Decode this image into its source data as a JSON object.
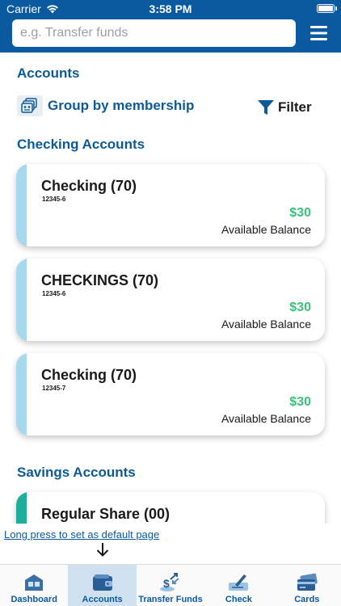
{
  "status_bar": {
    "carrier": "Carrier",
    "time": "3:58 PM",
    "battery_level": 1.0
  },
  "search": {
    "placeholder": "e.g. Transfer funds",
    "value": ""
  },
  "accounts": {
    "title": "Accounts",
    "group_by_label": "Group by membership",
    "filter_label": "Filter"
  },
  "checking": {
    "title": "Checking Accounts",
    "items": [
      {
        "name": "Checking (70)",
        "number": "12345-6",
        "amount": "$30",
        "balance_label": "Available Balance"
      },
      {
        "name": "CHECKINGS (70)",
        "number": "12345-6",
        "amount": "$30",
        "balance_label": "Available Balance"
      },
      {
        "name": "Checking (70)",
        "number": "12345-7",
        "amount": "$30",
        "balance_label": "Available Balance"
      }
    ]
  },
  "savings": {
    "title": "Savings Accounts",
    "items": [
      {
        "name": "Regular Share (00)"
      }
    ]
  },
  "hint": {
    "text": "Long press to set as default page"
  },
  "tabs": [
    {
      "label": "Dashboard",
      "icon": "dashboard-icon"
    },
    {
      "label": "Accounts",
      "icon": "wallet-icon",
      "active": true
    },
    {
      "label": "Transfer Funds",
      "icon": "transfer-funds-icon"
    },
    {
      "label": "Check",
      "icon": "check-deposit-icon"
    },
    {
      "label": "Cards",
      "icon": "cards-icon"
    }
  ],
  "colors": {
    "header": "#0b5aa0",
    "section_title": "#0c5a96",
    "amount": "#3cc07a",
    "checking_stripe": "#a8d8ee",
    "savings_stripe": "#1fae9a",
    "active_tab": "#cfe0ee"
  }
}
